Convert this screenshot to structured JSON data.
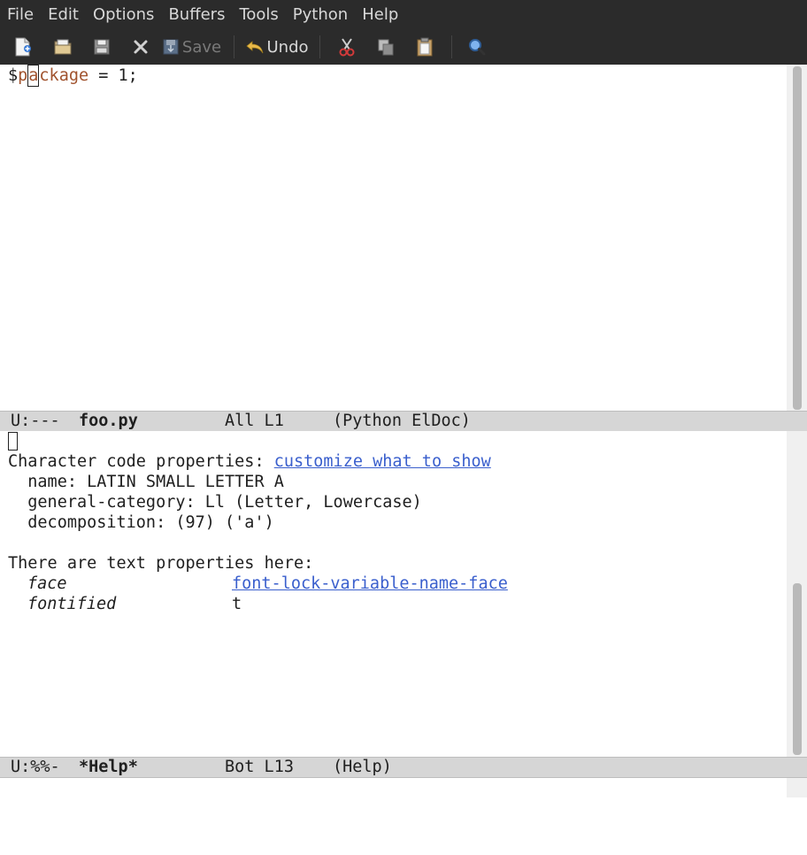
{
  "menubar": {
    "items": [
      "File",
      "Edit",
      "Options",
      "Buffers",
      "Tools",
      "Python",
      "Help"
    ]
  },
  "toolbar": {
    "save_label": "Save",
    "undo_label": "Undo"
  },
  "top_window": {
    "code": {
      "dollar": "$",
      "p": "p",
      "a": "a",
      "rest": "ckage",
      "tail": " = 1;"
    }
  },
  "top_modeline": {
    "status": "U:---",
    "buffer": "foo.py",
    "position": "All L1",
    "modes": "(Python ElDoc)"
  },
  "help_window": {
    "line1_prefix": "Character code properties: ",
    "line1_link": "customize what to show",
    "name_line": "  name: LATIN SMALL LETTER A",
    "category_line": "  general-category: Ll (Letter, Lowercase)",
    "decomposition_line": "  decomposition: (97) ('a')",
    "props_header": "There are text properties here:",
    "prop1_name": "face",
    "prop1_value": "font-lock-variable-name-face",
    "prop2_name": "fontified",
    "prop2_value": "t"
  },
  "bottom_modeline": {
    "status": "U:%%-",
    "buffer": "*Help*",
    "position": "Bot L13",
    "modes": "(Help)"
  }
}
